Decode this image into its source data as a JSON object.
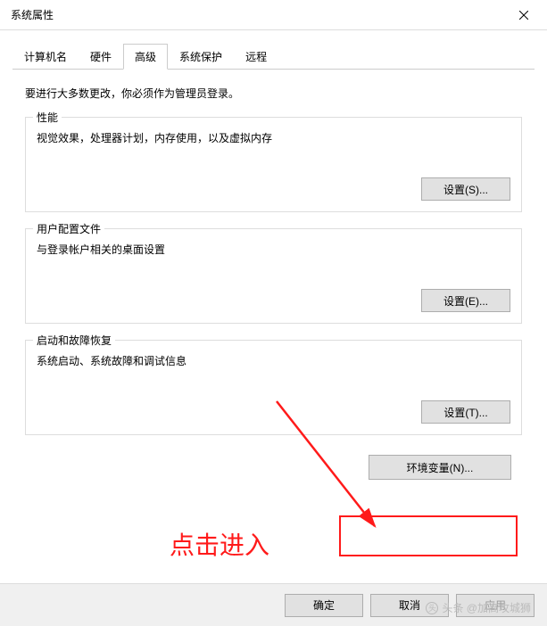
{
  "window": {
    "title": "系统属性"
  },
  "tabs": {
    "computer_name": "计算机名",
    "hardware": "硬件",
    "advanced": "高级",
    "system_protection": "系统保护",
    "remote": "远程"
  },
  "intro": "要进行大多数更改，你必须作为管理员登录。",
  "performance": {
    "legend": "性能",
    "desc": "视觉效果，处理器计划，内存使用，以及虚拟内存",
    "button": "设置(S)..."
  },
  "user_profiles": {
    "legend": "用户配置文件",
    "desc": "与登录帐户相关的桌面设置",
    "button": "设置(E)..."
  },
  "startup": {
    "legend": "启动和故障恢复",
    "desc": "系统启动、系统故障和调试信息",
    "button": "设置(T)..."
  },
  "env_vars": {
    "button": "环境变量(N)..."
  },
  "footer": {
    "ok": "确定",
    "cancel": "取消",
    "apply": "应用"
  },
  "annotation": {
    "label": "点击进入"
  },
  "watermark": {
    "text": "头条 @加高攻城狮"
  }
}
